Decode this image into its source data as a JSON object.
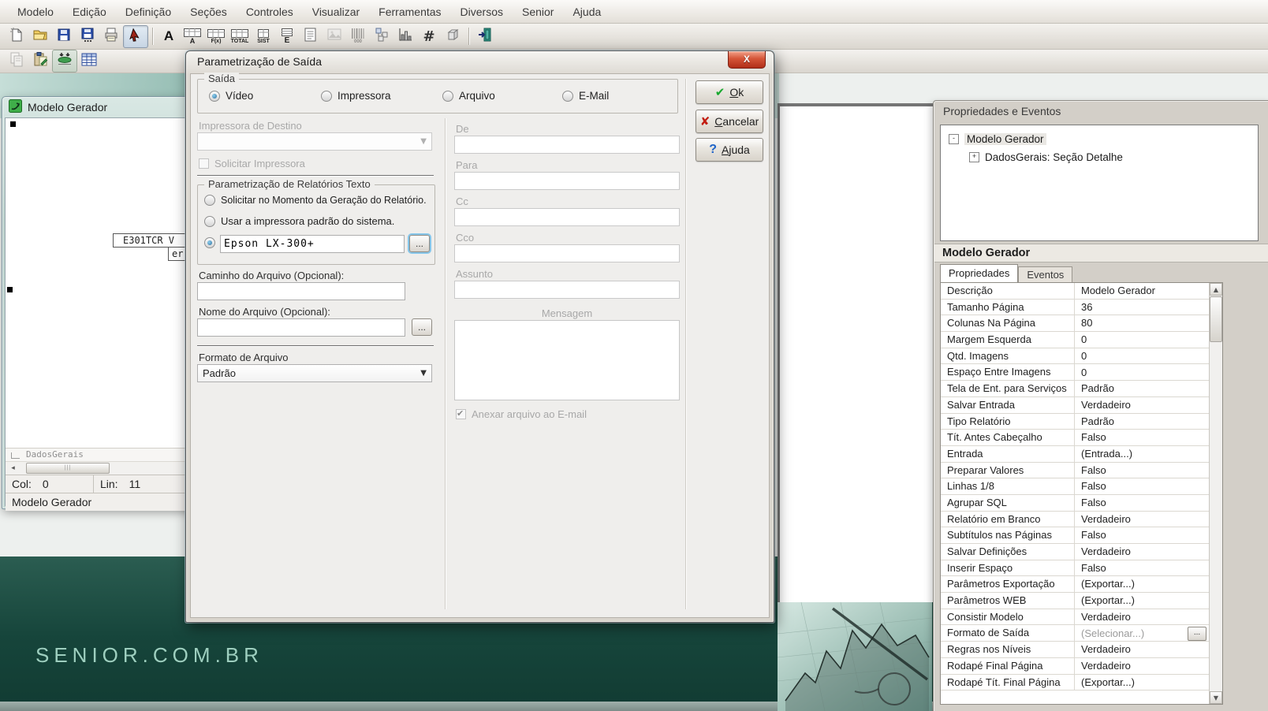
{
  "menu": {
    "items": [
      "Modelo",
      "Edição",
      "Definição",
      "Seções",
      "Controles",
      "Visualizar",
      "Ferramentas",
      "Diversos",
      "Senior",
      "Ajuda"
    ]
  },
  "toolbar": {
    "row1_icons": [
      "new-file",
      "open-folder",
      "save",
      "save-as",
      "print",
      "select-cursor",
      "letter-a",
      "field-a",
      "field-formula",
      "field-total",
      "field-system",
      "field-e",
      "document",
      "image",
      "barcode",
      "flowchart",
      "chart",
      "hash-grid",
      "cube",
      "exit"
    ],
    "row2_icons": [
      "copy",
      "paste-edit",
      "merge-rows",
      "table-grid"
    ],
    "field_labels": {
      "letter_a": "A",
      "a": "A",
      "fx": "F(x)",
      "total": "TOTAL",
      "sist": "SIST",
      "e": "E",
      "hash": "#",
      "barcode_digits": "000"
    }
  },
  "editor": {
    "title": "Modelo Gerador",
    "snippet1": "E301TCR V",
    "snippet2": "er",
    "section_label": "DadosGerais",
    "status": {
      "col_label": "Col:",
      "col_value": "0",
      "lin_label": "Lin:",
      "lin_value": "11"
    },
    "caption": "Modelo Gerador"
  },
  "dialog": {
    "title": "Parametrização de Saída",
    "close_glyph": "X",
    "saida": {
      "label": "Saída",
      "options": [
        {
          "label": "Vídeo",
          "selected": true
        },
        {
          "label": "Impressora",
          "selected": false
        },
        {
          "label": "Arquivo",
          "selected": false
        },
        {
          "label": "E-Mail",
          "selected": false
        }
      ]
    },
    "impressora_destino": {
      "label": "Impressora de Destino",
      "value": ""
    },
    "solicitar_impressora": {
      "label": "Solicitar Impressora",
      "checked": false
    },
    "relatorios_texto": {
      "label": "Parametrização de Relatórios Texto",
      "option1": "Solicitar no Momento da Geração do Relatório.",
      "option2": "Usar a impressora padrão do sistema.",
      "printer_value": "Epson LX-300+",
      "browse_label": "..."
    },
    "caminho": {
      "label": "Caminho do Arquivo (Opcional):",
      "value": ""
    },
    "nome": {
      "label": "Nome do Arquivo (Opcional):",
      "value": "",
      "browse_label": "..."
    },
    "formato": {
      "label": "Formato de Arquivo",
      "value": "Padrão"
    },
    "email": {
      "de": "De",
      "para": "Para",
      "cc": "Cc",
      "cco": "Cco",
      "assunto": "Assunto",
      "mensagem": "Mensagem",
      "anexar": "Anexar arquivo ao E-mail",
      "anexar_checked": true
    },
    "buttons": {
      "ok": "Ok",
      "cancel": "Cancelar",
      "help": "Ajuda",
      "ok_glyph": "✔",
      "cancel_glyph": "✘",
      "help_glyph": "?"
    }
  },
  "panel": {
    "title": "Propriedades e Eventos",
    "tree": [
      {
        "expander": "-",
        "label": "Modelo Gerador"
      },
      {
        "expander": "+",
        "label": "DadosGerais: Seção Detalhe"
      }
    ],
    "section_header": "Modelo Gerador",
    "tabs": [
      {
        "label": "Propriedades",
        "active": true
      },
      {
        "label": "Eventos",
        "active": false
      }
    ],
    "grid": {
      "browse_label": "...",
      "rows": [
        {
          "name": "Descrição",
          "value": "Modelo Gerador"
        },
        {
          "name": "Tamanho Página",
          "value": "36"
        },
        {
          "name": "Colunas Na Página",
          "value": "80"
        },
        {
          "name": "Margem Esquerda",
          "value": "0"
        },
        {
          "name": "Qtd. Imagens",
          "value": "0"
        },
        {
          "name": "Espaço Entre Imagens",
          "value": "0"
        },
        {
          "name": "Tela de Ent. para Serviços",
          "value": "Padrão"
        },
        {
          "name": "Salvar Entrada",
          "value": "Verdadeiro"
        },
        {
          "name": "Tipo Relatório",
          "value": "Padrão"
        },
        {
          "name": "Tít. Antes Cabeçalho",
          "value": "Falso"
        },
        {
          "name": "Entrada",
          "value": "(Entrada...)"
        },
        {
          "name": "Preparar Valores",
          "value": "Falso"
        },
        {
          "name": "Linhas 1/8",
          "value": "Falso"
        },
        {
          "name": "Agrupar SQL",
          "value": "Falso"
        },
        {
          "name": "Relatório em Branco",
          "value": "Verdadeiro"
        },
        {
          "name": "Subtítulos nas Páginas",
          "value": "Falso"
        },
        {
          "name": "Salvar Definições",
          "value": "Verdadeiro"
        },
        {
          "name": "Inserir Espaço",
          "value": "Falso"
        },
        {
          "name": "Parâmetros Exportação",
          "value": "(Exportar...)"
        },
        {
          "name": "Parâmetros WEB",
          "value": "(Exportar...)"
        },
        {
          "name": "Consistir Modelo",
          "value": "Verdadeiro"
        },
        {
          "name": "Formato de Saída",
          "value": "(Selecionar...)"
        },
        {
          "name": "Regras nos Níveis",
          "value": "Verdadeiro"
        },
        {
          "name": "Rodapé Final Página",
          "value": "Verdadeiro"
        },
        {
          "name": "Rodapé Tít. Final Página",
          "value": "(Exportar...)"
        }
      ]
    }
  },
  "background": {
    "brand": "SENIOR.COM.BR"
  },
  "colors": {
    "ok_green": "#18a82e",
    "cancel_red": "#c21d12",
    "help_blue": "#1f64c8",
    "brand_text": "#9ecfbf",
    "dark_green": "#16453b",
    "radio_dot": "#2f6f9e"
  }
}
